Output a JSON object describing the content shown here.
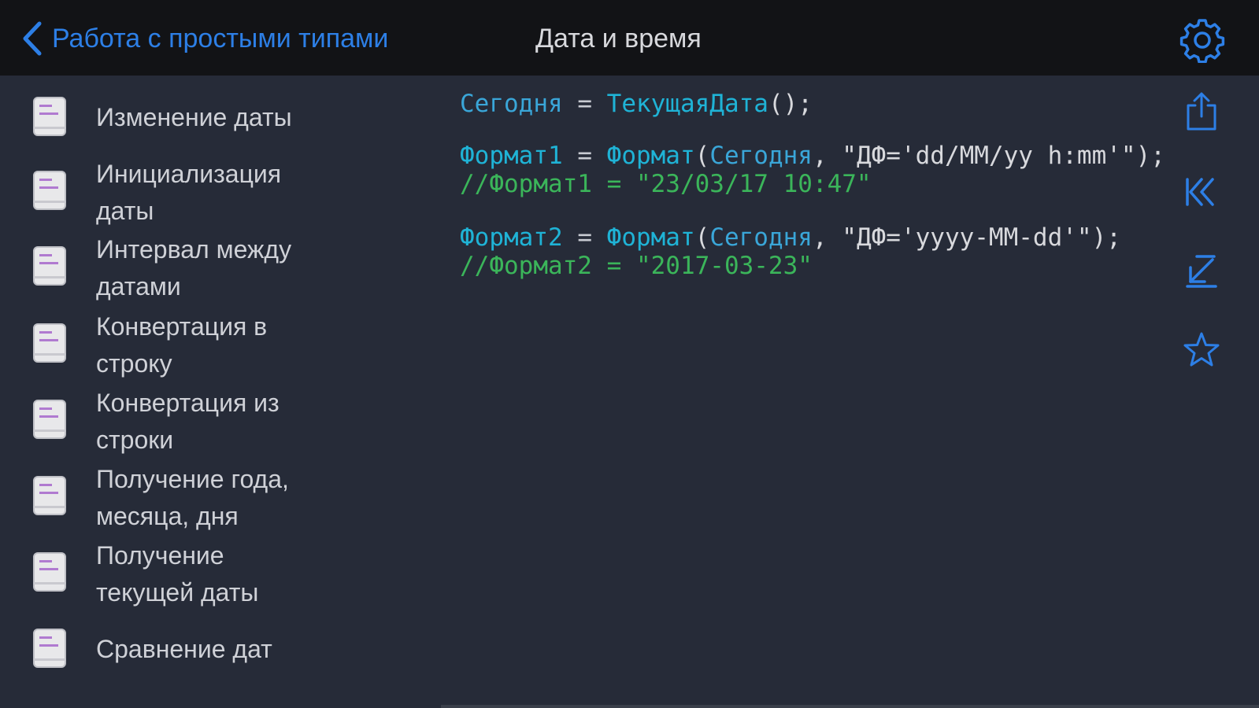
{
  "navbar": {
    "back_label": "Работа с простыми типами",
    "title": "Дата и время",
    "accent": "#2d7fe6"
  },
  "sidebar": {
    "items": [
      {
        "label": "Изменение даты"
      },
      {
        "label": "Инициализация даты"
      },
      {
        "label": "Интервал между датами"
      },
      {
        "label": "Конвертация в строку"
      },
      {
        "label": "Конвертация из строки"
      },
      {
        "label": "Получение года, месяца, дня"
      },
      {
        "label": "Получение текущей даты"
      },
      {
        "label": "Сравнение дат"
      }
    ],
    "item_icon": "code-file-icon"
  },
  "code": {
    "line1": {
      "var": "Сегодня",
      "eq": " = ",
      "func": "ТекущаяДата",
      "rest": "();"
    },
    "line2": {
      "var": "Формат1",
      "eq": " = ",
      "func": "Формат",
      "p1": "(",
      "arg": "Сегодня",
      "rest": ", \"ДФ='dd/MM/yy h:mm'\");"
    },
    "line3": "//Формат1 = \"23/03/17 10:47\"",
    "line4": {
      "var": "Формат2",
      "eq": " = ",
      "func": "Формат",
      "p1": "(",
      "arg": "Сегодня",
      "rest": ", \"ДФ='yyyy-MM-dd'\");"
    },
    "line5": "//Формат2 = \"2017-03-23\""
  },
  "toolbar": {
    "icons": [
      "share-icon",
      "collapse-left-icon",
      "collapse-down-icon",
      "star-icon"
    ],
    "settings_icon": "gear-icon"
  }
}
